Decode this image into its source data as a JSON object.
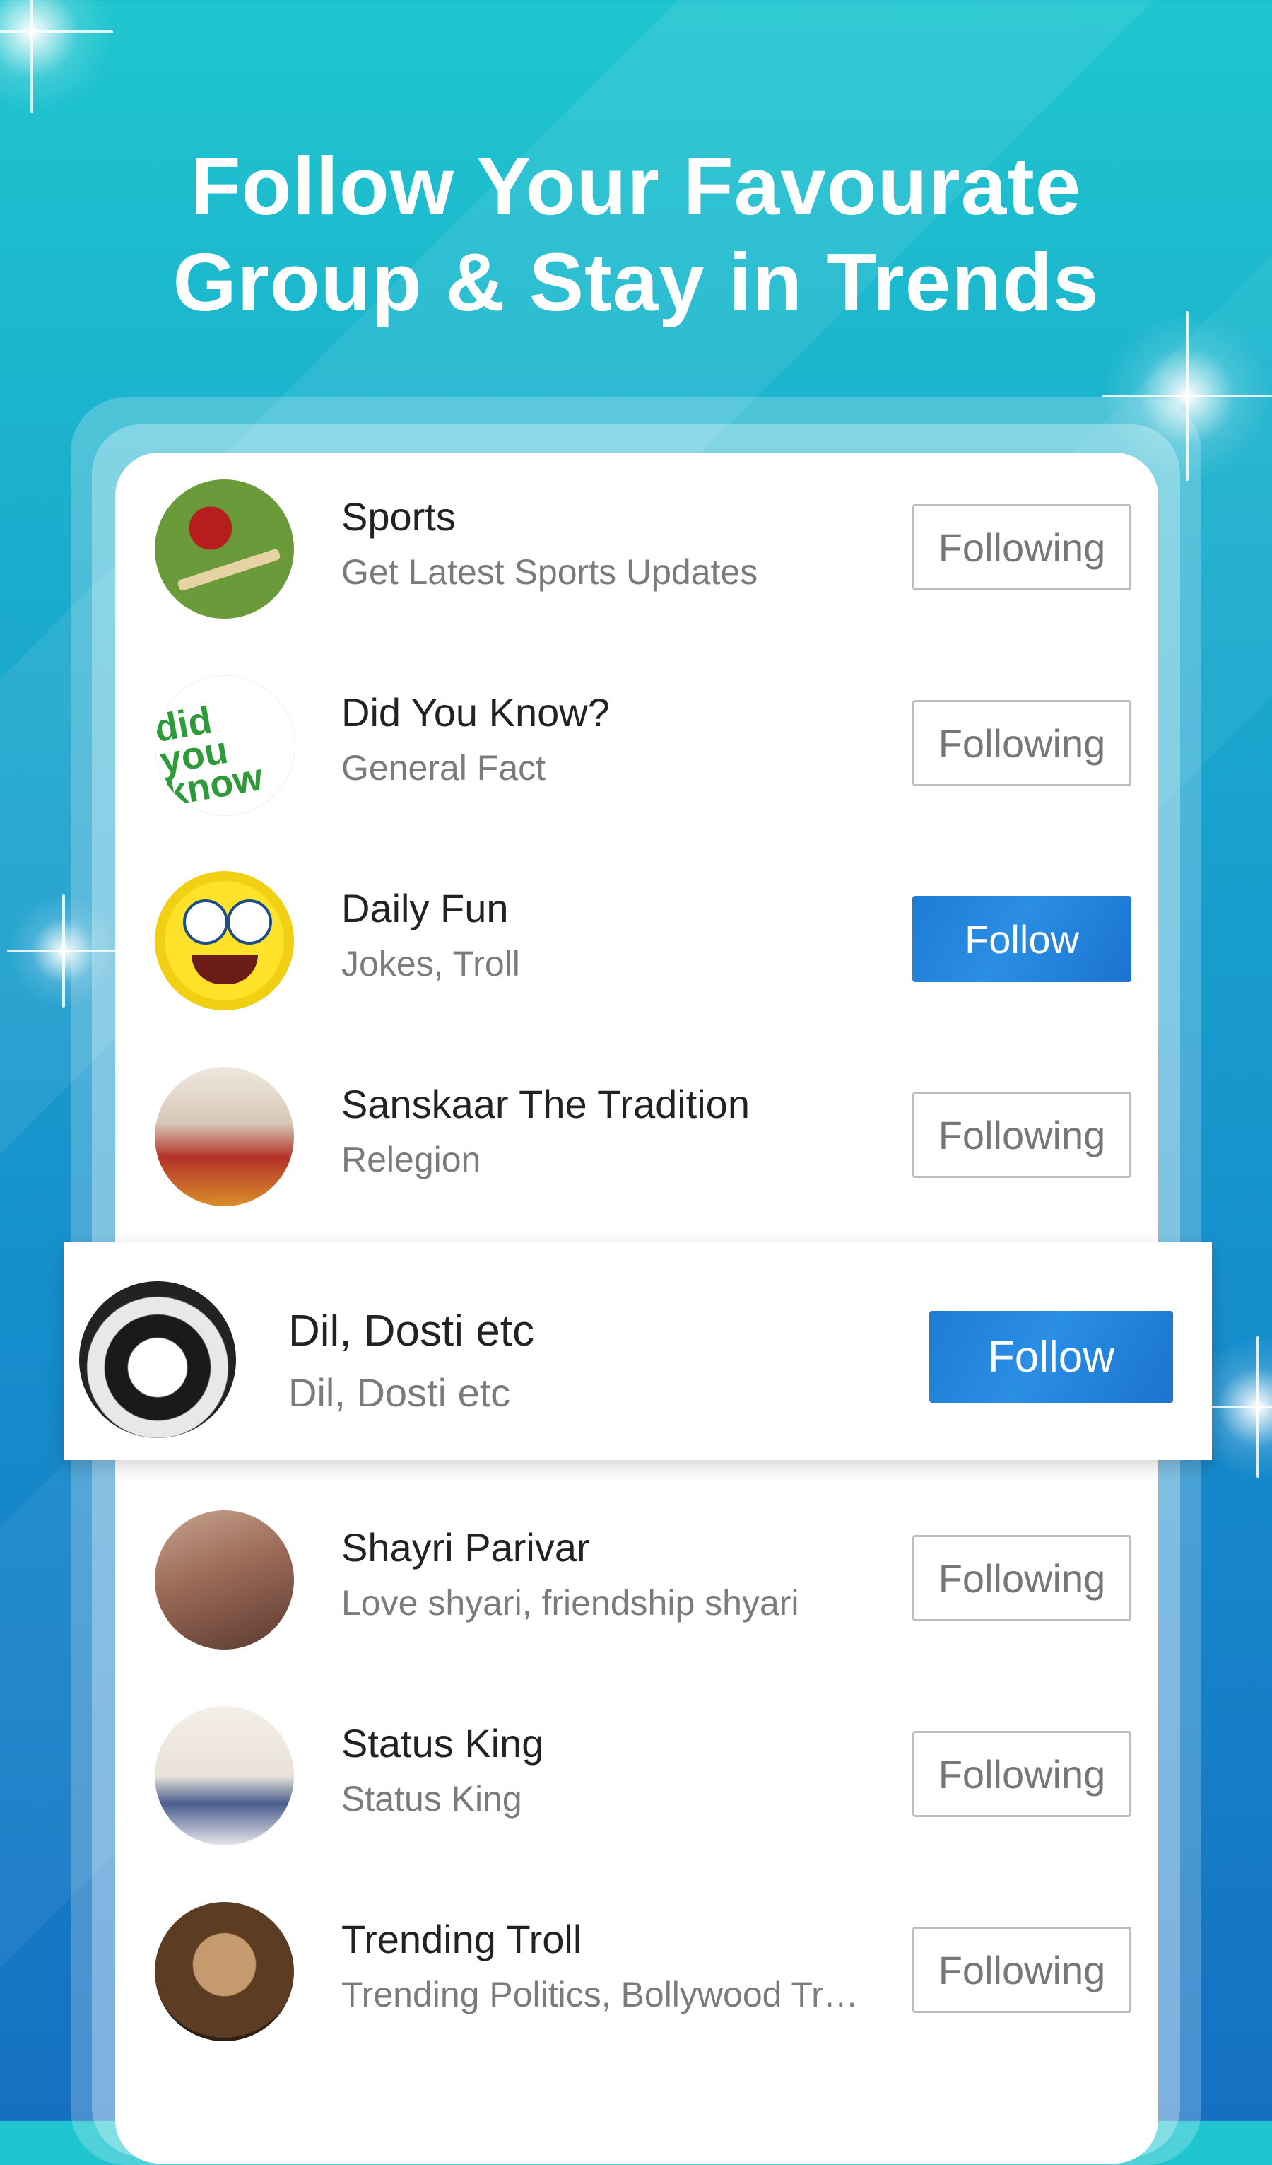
{
  "headline": {
    "line1": "Follow Your Favourate",
    "line2": "Group & Stay in Trends"
  },
  "groups": [
    {
      "name": "Sports",
      "subtitle": "Get Latest Sports Updates",
      "button": "Following",
      "avatar_icon": "cricket-ball-avatar"
    },
    {
      "name": "Did You Know?",
      "subtitle": "General Fact",
      "button": "Following",
      "avatar_icon": "did-you-know-avatar"
    },
    {
      "name": "Daily Fun",
      "subtitle": "Jokes, Troll",
      "button": "Follow",
      "avatar_icon": "spongebob-avatar"
    },
    {
      "name": "Sanskaar The Tradition",
      "subtitle": "Relegion",
      "button": "Following",
      "avatar_icon": "family-avatar"
    },
    {
      "name": "Dil, Dosti etc",
      "subtitle": "Dil, Dosti etc",
      "button": "Follow",
      "avatar_icon": "friendship-hands-avatar"
    },
    {
      "name": "Shayri Parivar",
      "subtitle": "Love shyari, friendship shyari",
      "button": "Following",
      "avatar_icon": "hindi-text-avatar"
    },
    {
      "name": "Status King",
      "subtitle": "Status King",
      "button": "Following",
      "avatar_icon": "boy-sunglasses-avatar"
    },
    {
      "name": "Trending Troll",
      "subtitle": "Trending Politics, Bollywood Tr…",
      "button": "Following",
      "avatar_icon": "monkey-avatar"
    }
  ],
  "colors": {
    "follow_button": "#1e7bd6",
    "following_border": "#bdbdbd",
    "background_top": "#1fc6cf",
    "background_bottom": "#1570c2"
  }
}
